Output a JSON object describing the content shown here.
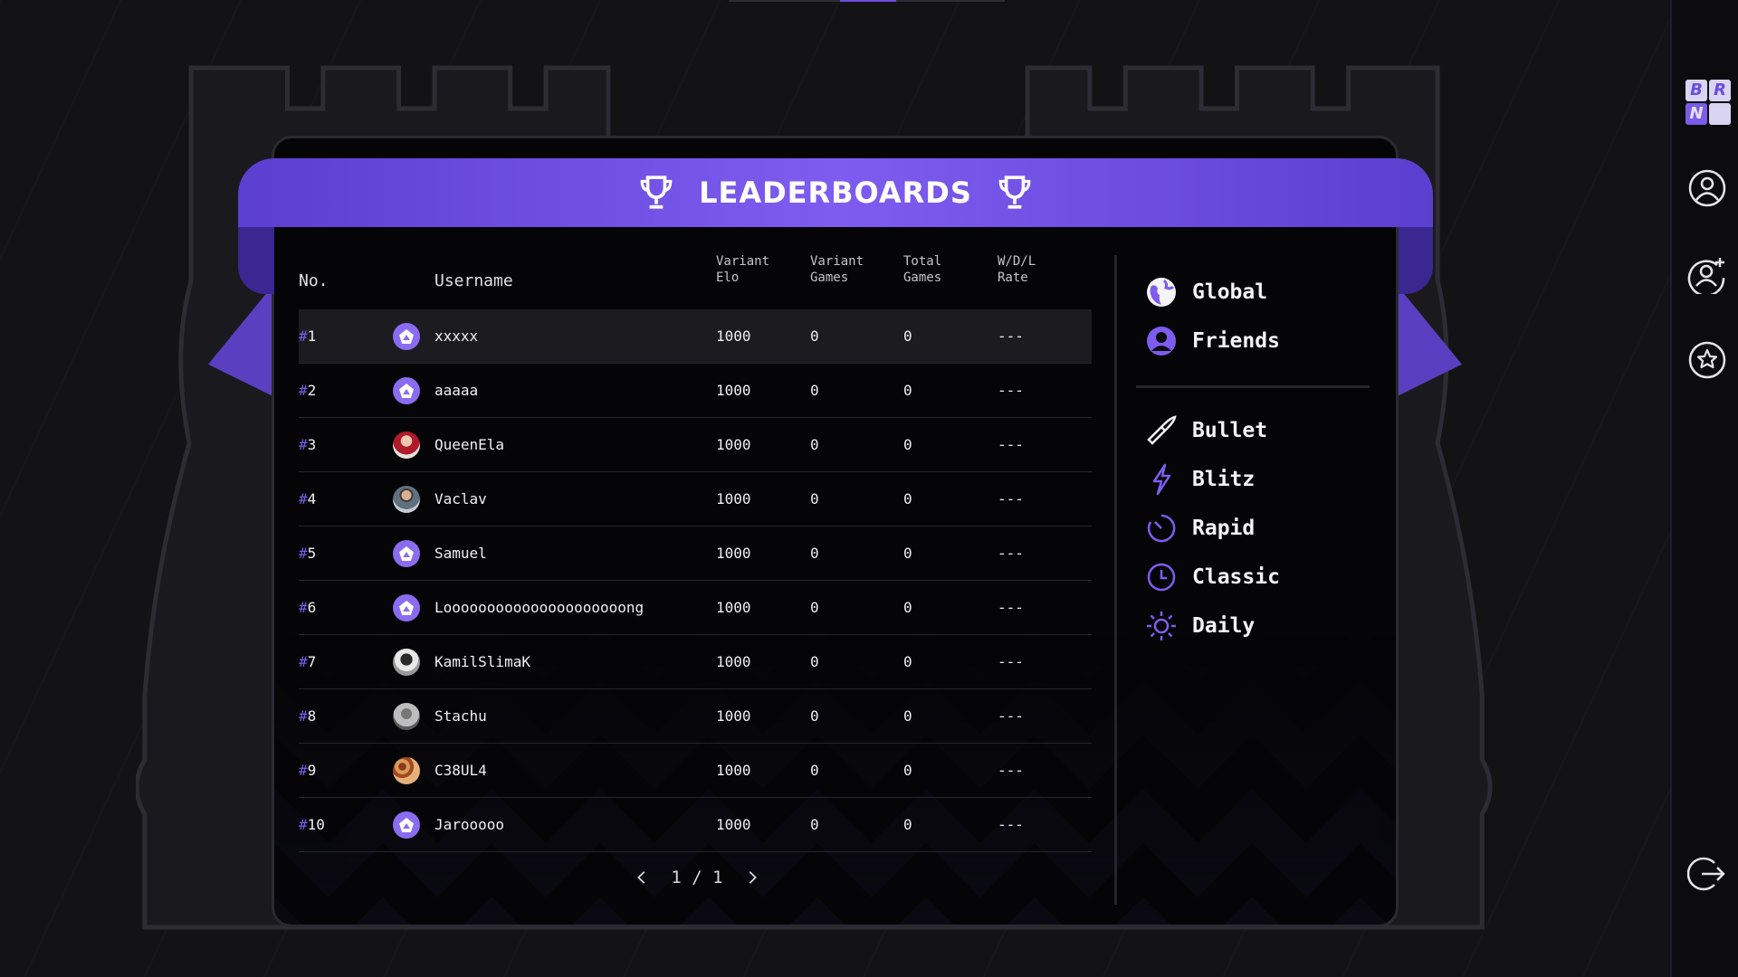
{
  "header": {
    "title": "LEADERBOARDS"
  },
  "table": {
    "columns": {
      "no": "No.",
      "username": "Username",
      "variant_elo": [
        "Variant",
        "Elo"
      ],
      "variant_games": [
        "Variant",
        "Games"
      ],
      "total_games": [
        "Total",
        "Games"
      ],
      "wdl_rate": [
        "W/D/L",
        "Rate"
      ]
    },
    "rows": [
      {
        "rank": "1",
        "username": "xxxxx",
        "elo": "1000",
        "variant_games": "0",
        "total_games": "0",
        "rate": "---",
        "avatar": "default"
      },
      {
        "rank": "2",
        "username": "aaaaa",
        "elo": "1000",
        "variant_games": "0",
        "total_games": "0",
        "rate": "---",
        "avatar": "default"
      },
      {
        "rank": "3",
        "username": "QueenEla",
        "elo": "1000",
        "variant_games": "0",
        "total_games": "0",
        "rate": "---",
        "avatar": "photo-red"
      },
      {
        "rank": "4",
        "username": "Vaclav",
        "elo": "1000",
        "variant_games": "0",
        "total_games": "0",
        "rate": "---",
        "avatar": "photo-man"
      },
      {
        "rank": "5",
        "username": "Samuel",
        "elo": "1000",
        "variant_games": "0",
        "total_games": "0",
        "rate": "---",
        "avatar": "default"
      },
      {
        "rank": "6",
        "username": "Looooooooooooooooooooong",
        "elo": "1000",
        "variant_games": "0",
        "total_games": "0",
        "rate": "---",
        "avatar": "default"
      },
      {
        "rank": "7",
        "username": "KamilSlimaK",
        "elo": "1000",
        "variant_games": "0",
        "total_games": "0",
        "rate": "---",
        "avatar": "photo-bw"
      },
      {
        "rank": "8",
        "username": "Stachu",
        "elo": "1000",
        "variant_games": "0",
        "total_games": "0",
        "rate": "---",
        "avatar": "photo-gray"
      },
      {
        "rank": "9",
        "username": "C38UL4",
        "elo": "1000",
        "variant_games": "0",
        "total_games": "0",
        "rate": "---",
        "avatar": "photo-food"
      },
      {
        "rank": "10",
        "username": "Jarooooo",
        "elo": "1000",
        "variant_games": "0",
        "total_games": "0",
        "rate": "---",
        "avatar": "default"
      }
    ]
  },
  "pagination": {
    "current": "1",
    "separator": "/",
    "total": "1"
  },
  "filters": {
    "scope": [
      {
        "label": "Global",
        "icon": "globe-icon"
      },
      {
        "label": "Friends",
        "icon": "user-circle-icon"
      }
    ],
    "timing": [
      {
        "label": "Bullet",
        "icon": "bullet-icon"
      },
      {
        "label": "Blitz",
        "icon": "lightning-icon"
      },
      {
        "label": "Rapid",
        "icon": "timer-icon"
      },
      {
        "label": "Classic",
        "icon": "clock-icon"
      },
      {
        "label": "Daily",
        "icon": "sun-icon"
      }
    ]
  },
  "sidebar": {
    "logo_letters": [
      "B",
      "R",
      "N",
      ""
    ],
    "buttons": [
      "profile-icon",
      "add-friend-icon",
      "star-badge-icon",
      "logout-icon"
    ]
  },
  "colors": {
    "accent": "#7e5cf0",
    "background": "#131316",
    "panel": "#050507"
  }
}
